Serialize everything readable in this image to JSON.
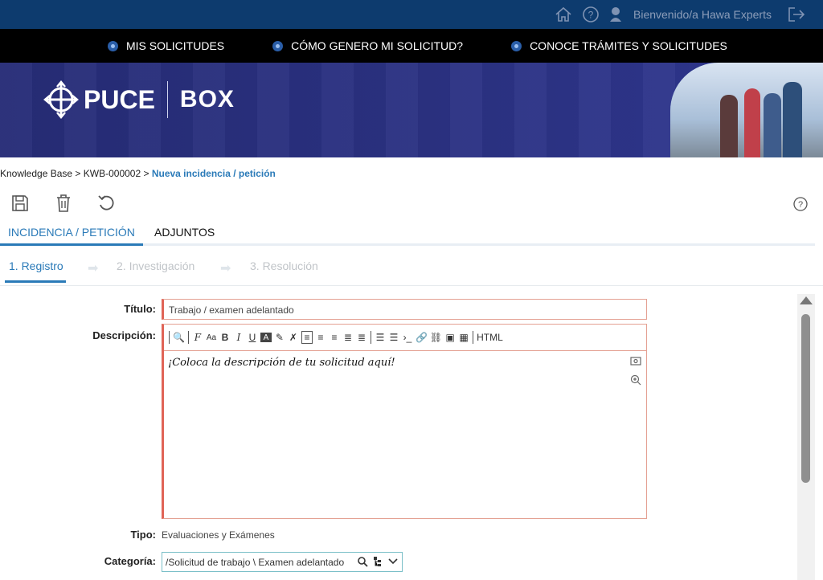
{
  "topbar": {
    "welcome": "Bienvenido/a Hawa Experts",
    "icons": [
      "home-icon",
      "help-icon",
      "user-icon",
      "logout-icon"
    ]
  },
  "nav": {
    "items": [
      {
        "label": "MIS SOLICITUDES"
      },
      {
        "label": "CÓMO GENERO MI SOLICITUD?"
      },
      {
        "label": "CONOCE TRÁMITES Y SOLICITUDES"
      }
    ]
  },
  "banner": {
    "brand": "PUCE",
    "product": "BOX"
  },
  "breadcrumb": {
    "root": "Knowledge Base",
    "sep": " > ",
    "kb": "KWB-000002",
    "current": "Nueva incidencia / petición"
  },
  "tabs": {
    "main": "INCIDENCIA / PETICIÓN",
    "attachments": "ADJUNTOS"
  },
  "steps": [
    "1. Registro",
    "2. Investigación",
    "3. Resolución"
  ],
  "form": {
    "title_label": "Título:",
    "title_value": "Trabajo / examen adelantado",
    "description_label": "Descripción:",
    "description_value": "¡Coloca la descripción de tu solicitud aquí!",
    "editor_html": "HTML",
    "tipo_label": "Tipo:",
    "tipo_value": "Evaluaciones y Exámenes",
    "categoria_label": "Categoría:",
    "categoria_value": "/Solicitud de trabajo \\ Examen adelantado"
  },
  "colors": {
    "topbar": "#0d3b6e",
    "navbar": "#000000",
    "accent": "#2a7ab8",
    "required_border": "#e06457"
  }
}
